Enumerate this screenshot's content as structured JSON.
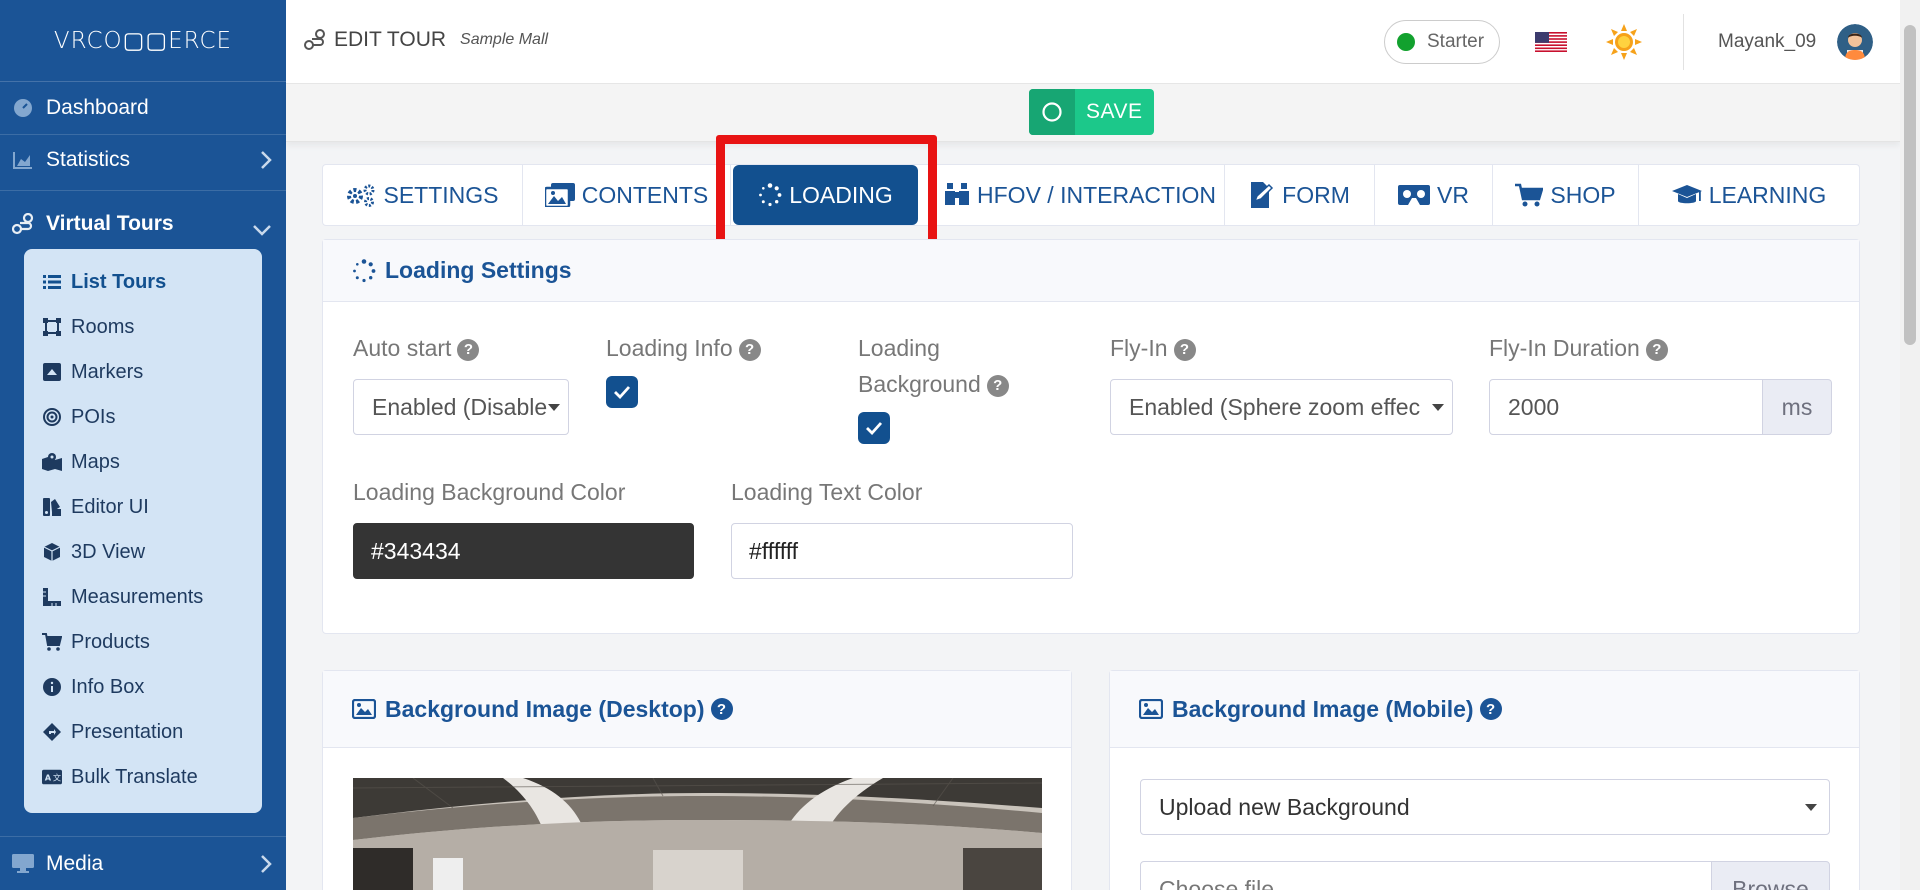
{
  "brand": {
    "logo": "VRCO▢▢ERCE"
  },
  "sidebar": {
    "items": [
      {
        "label": "Dashboard"
      },
      {
        "label": "Statistics"
      },
      {
        "label": "Virtual Tours"
      },
      {
        "label": "Media"
      }
    ],
    "subitems": [
      {
        "label": "List Tours"
      },
      {
        "label": "Rooms"
      },
      {
        "label": "Markers"
      },
      {
        "label": "POIs"
      },
      {
        "label": "Maps"
      },
      {
        "label": "Editor UI"
      },
      {
        "label": "3D View"
      },
      {
        "label": "Measurements"
      },
      {
        "label": "Products"
      },
      {
        "label": "Info Box"
      },
      {
        "label": "Presentation"
      },
      {
        "label": "Bulk Translate"
      }
    ]
  },
  "header": {
    "title": "EDIT TOUR",
    "subtitle": "Sample Mall",
    "plan": "Starter",
    "plan_color": "#12a12e",
    "username": "Mayank_09"
  },
  "toolbar": {
    "save_label": "SAVE"
  },
  "tabs": [
    {
      "label": "SETTINGS",
      "icon": "gears-icon"
    },
    {
      "label": "CONTENTS",
      "icon": "images-icon"
    },
    {
      "label": "LOADING",
      "icon": "spinner-icon",
      "active": true
    },
    {
      "label": "HFOV / INTERACTION",
      "icon": "binoculars-icon"
    },
    {
      "label": "FORM",
      "icon": "file-edit-icon"
    },
    {
      "label": "VR",
      "icon": "vr-cardboard-icon"
    },
    {
      "label": "SHOP",
      "icon": "cart-icon"
    },
    {
      "label": "LEARNING",
      "icon": "graduation-cap-icon"
    }
  ],
  "loading_settings": {
    "title": "Loading Settings",
    "auto_start": {
      "label": "Auto start",
      "value": "Enabled (Disable"
    },
    "loading_info": {
      "label": "Loading Info",
      "checked": true
    },
    "loading_background": {
      "label_line1": "Loading",
      "label_line2": "Background",
      "checked": true
    },
    "fly_in": {
      "label": "Fly-In",
      "value": "Enabled (Sphere zoom effec"
    },
    "fly_in_duration": {
      "label": "Fly-In Duration",
      "value": "2000",
      "unit": "ms"
    },
    "bg_color": {
      "label": "Loading Background Color",
      "value": "#343434"
    },
    "text_color": {
      "label": "Loading Text Color",
      "value": "#ffffff"
    }
  },
  "bg_desktop": {
    "title": "Background Image (Desktop)"
  },
  "bg_mobile": {
    "title": "Background Image (Mobile)",
    "select_value": "Upload new Background",
    "file_placeholder": "Choose file",
    "browse_label": "Browse"
  },
  "colors": {
    "sidebar": "#1b5496",
    "accent": "#12508f",
    "save": "#1cc88a",
    "highlight": "#e81313"
  }
}
